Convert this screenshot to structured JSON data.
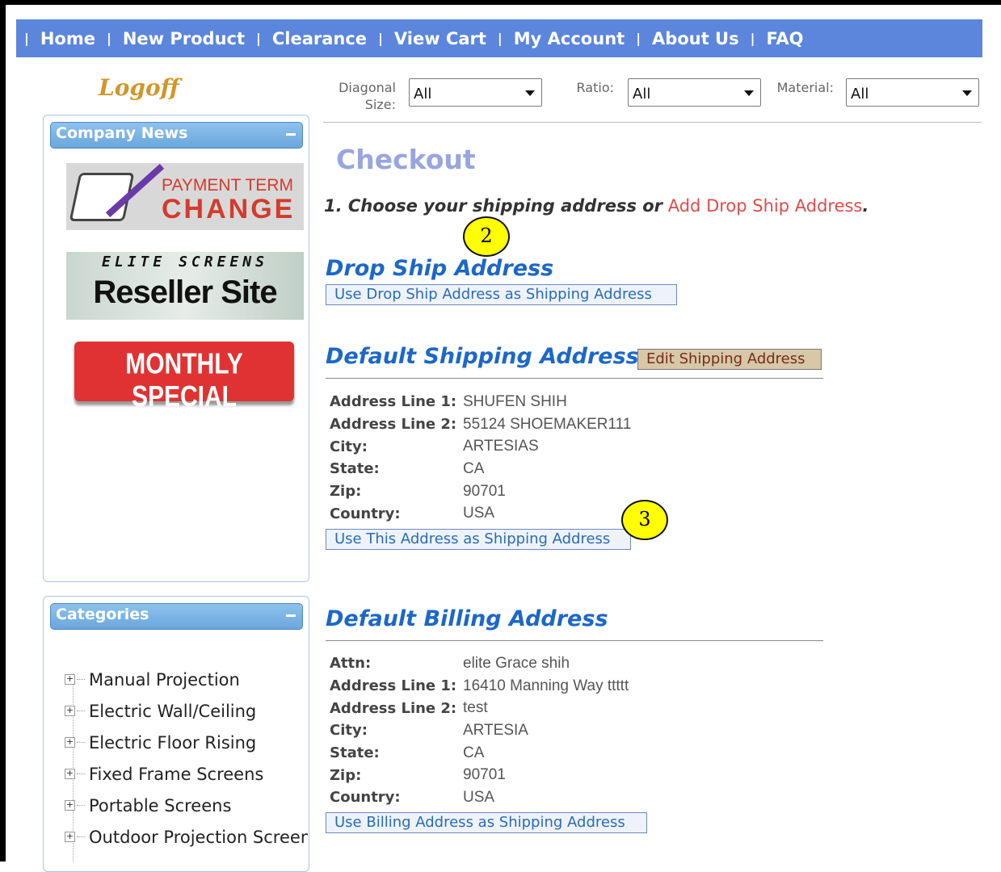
{
  "nav": {
    "items": [
      "Home",
      "New Product",
      "Clearance",
      "View Cart",
      "My Account",
      "About Us",
      "FAQ"
    ],
    "separator": "|"
  },
  "sidebar": {
    "logoff": "Logoff",
    "news_panel": {
      "title": "Company News",
      "banners": {
        "payment_term_line1": "PAYMENT TERM",
        "payment_term_line2": "CHANGE",
        "reseller_line1": "ELITE SCREENS",
        "reseller_line2": "Reseller Site",
        "monthly_special": "MONTHLY SPECIAL"
      }
    },
    "categories_panel": {
      "title": "Categories",
      "items": [
        "Manual Projection",
        "Electric Wall/Ceiling",
        "Electric Floor Rising",
        "Fixed Frame Screens",
        "Portable Screens",
        "Outdoor Projection Screen"
      ]
    }
  },
  "filters": {
    "diagonal_label_1": "Diagonal",
    "diagonal_label_2": "Size:",
    "diagonal_value": "All",
    "ratio_label": "Ratio:",
    "ratio_value": "All",
    "material_label": "Material:",
    "material_value": "All"
  },
  "main": {
    "title": "Checkout",
    "step_text": "1. Choose your shipping address or",
    "step_link": "Add Drop Ship Address",
    "step_end": ".",
    "drop_ship": {
      "title": "Drop Ship Address",
      "button": "Use Drop Ship Address as Shipping Address"
    },
    "shipping": {
      "title": "Default Shipping Address",
      "edit_button": "Edit Shipping Address",
      "rows": [
        {
          "label": "Address Line 1:",
          "value": "SHUFEN SHIH"
        },
        {
          "label": "Address Line 2:",
          "value": "55124 SHOEMAKER111"
        },
        {
          "label": "City:",
          "value": "ARTESIAS"
        },
        {
          "label": "State:",
          "value": "CA"
        },
        {
          "label": "Zip:",
          "value": "90701"
        },
        {
          "label": "Country:",
          "value": "USA"
        }
      ],
      "button": "Use This Address as Shipping Address"
    },
    "billing": {
      "title": "Default Billing Address",
      "rows": [
        {
          "label": "Attn:",
          "value": "elite Grace shih"
        },
        {
          "label": "Address Line 1:",
          "value": "16410 Manning Way ttttt"
        },
        {
          "label": "Address Line 2:",
          "value": "test"
        },
        {
          "label": "City:",
          "value": "ARTESIA"
        },
        {
          "label": "State:",
          "value": "CA"
        },
        {
          "label": "Zip:",
          "value": "90701"
        },
        {
          "label": "Country:",
          "value": "USA"
        }
      ],
      "button": "Use Billing Address as Shipping Address"
    }
  },
  "callouts": [
    "2",
    "3"
  ]
}
